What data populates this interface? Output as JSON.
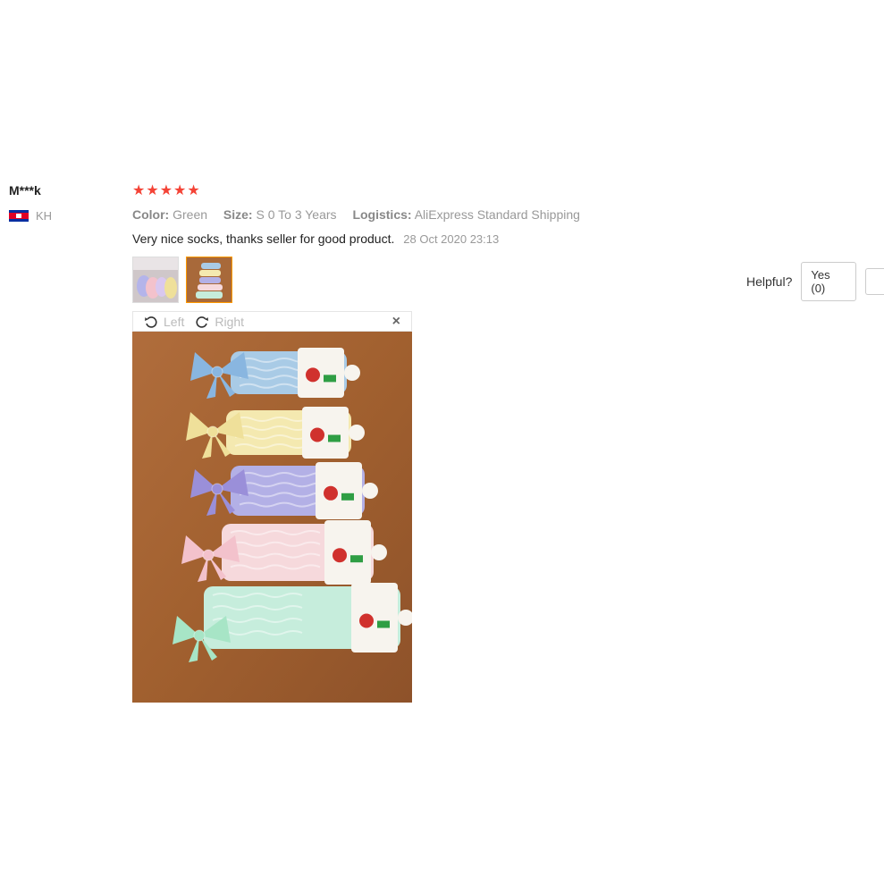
{
  "user": {
    "name": "M***k",
    "country": "KH"
  },
  "rating": {
    "stars": 5,
    "max": 5
  },
  "attributes": [
    {
      "key": "Color:",
      "value": "Green"
    },
    {
      "key": "Size:",
      "value": "S 0 To 3 Years"
    },
    {
      "key": "Logistics:",
      "value": "AliExpress Standard Shipping"
    }
  ],
  "review": {
    "text": "Very nice socks, thanks seller for good product.",
    "date": "28 Oct 2020 23:13"
  },
  "viewer": {
    "left_label": "Left",
    "right_label": "Right",
    "close_label": "×"
  },
  "helpful": {
    "label": "Helpful?",
    "yes_label": "Yes (0)"
  },
  "colors": {
    "star": "#f44336",
    "thumb_active": "#ff9900"
  },
  "socks": [
    {
      "sock_color": "#a9cbe6",
      "bow_color": "#89b6e0"
    },
    {
      "sock_color": "#f4e9b0",
      "bow_color": "#efe09a"
    },
    {
      "sock_color": "#b3b0e6",
      "bow_color": "#9a8fd9"
    },
    {
      "sock_color": "#f6d9dc",
      "bow_color": "#f3c2cc"
    },
    {
      "sock_color": "#c6eddc",
      "bow_color": "#a7e5c6"
    }
  ]
}
